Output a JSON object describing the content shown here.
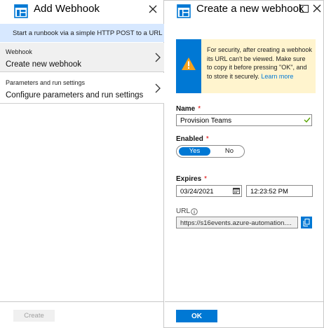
{
  "left_blade": {
    "title": "Add Webhook",
    "icon": "automation-blade-icon",
    "info": "Start a runbook via a simple HTTP POST to a URL",
    "menu": [
      {
        "small": "Webhook",
        "big": "Create new webhook"
      },
      {
        "small": "Parameters and run settings",
        "big": "Configure parameters and run settings"
      }
    ],
    "create_label": "Create"
  },
  "right_blade": {
    "title": "Create a new webhook",
    "icon": "automation-blade-icon",
    "warning": {
      "text": "For security, after creating a webhook its URL can't be viewed. Make sure to copy it before pressing \"OK\", and to store it securely.",
      "link": "Learn more"
    },
    "name": {
      "label": "Name",
      "required": "*",
      "value": "Provision Teams"
    },
    "enabled": {
      "label": "Enabled",
      "required": "*",
      "yes": "Yes",
      "no": "No",
      "selected": "Yes"
    },
    "expires": {
      "label": "Expires",
      "required": "*",
      "date": "03/24/2021",
      "time": "12:23:52 PM"
    },
    "url": {
      "label": "URL",
      "value": "https://s16events.azure-automation...."
    },
    "ok_label": "OK"
  },
  "colors": {
    "accent": "#0078d4",
    "info_bar": "#d7e8ff",
    "warning_bg": "#fff4ce",
    "warning_icon": "#f7a21b",
    "required": "#d00000",
    "valid_check": "#57a300"
  }
}
